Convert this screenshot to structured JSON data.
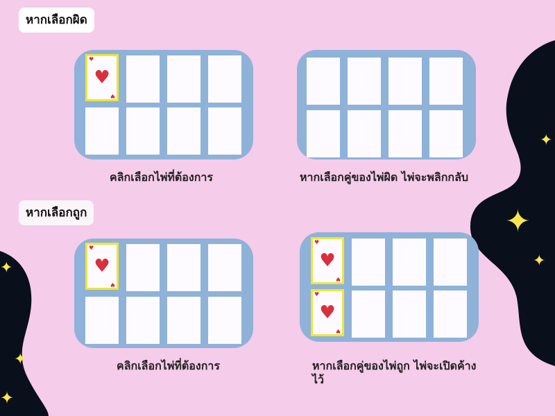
{
  "sections": {
    "wrong": {
      "label": "หากเลือกผิด",
      "caption_left": "คลิกเลือกไพ่ที่ต้องการ",
      "caption_right": "หากเลือกคู่ของไพ่ผิด ไพ่จะพลิกกลับ"
    },
    "right": {
      "label": "หากเลือกถูก",
      "caption_left": "คลิกเลือกไพ่ที่ต้องการ",
      "caption_right_line1": "หากเลือกคู่ของไพ่ถูก ไพ่จะเปิดค้าง",
      "caption_right_line2": "ไว้"
    }
  },
  "card": {
    "suit_symbol": "♥",
    "suit": "hearts",
    "face_color": "#d8303c"
  },
  "colors": {
    "background": "#f5cce9",
    "panel": "#8fb2d9",
    "card": "#fdfbff",
    "selected_border": "#f2e533",
    "blob": "#0a0f1c",
    "sparkle": "#f9e64c"
  },
  "icons": [
    "heart-icon",
    "sparkle-icon"
  ]
}
